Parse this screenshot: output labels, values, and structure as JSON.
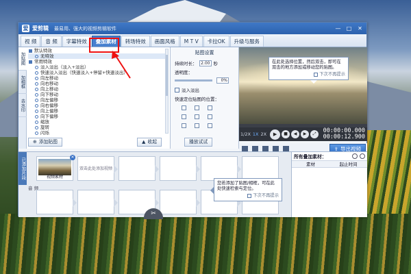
{
  "colors": {
    "accent": "#4680cf",
    "titlebar": "#2c62ae",
    "highlight": "#e11111"
  },
  "app": {
    "logo_glyph": "爱",
    "name": "爱剪辑",
    "slogan": "最易用、强大的视频剪辑软件",
    "win_minimize": "—",
    "win_maximize": "□",
    "win_close": "✕"
  },
  "tabs": [
    "视 频",
    "音 频",
    "字幕特效",
    "叠加素材",
    "转场特效",
    "画面风格",
    "M T V",
    "卡拉OK",
    "升级与服务"
  ],
  "sidetabs": [
    "加贴图",
    "加相框",
    "去水印"
  ],
  "tree": [
    {
      "type": "group",
      "label": "默认特效"
    },
    {
      "type": "item",
      "label": "无特效",
      "selected": true
    },
    {
      "type": "group",
      "label": "常用特效"
    },
    {
      "type": "item",
      "label": "淡入淡出（淡入+淡出）"
    },
    {
      "type": "item",
      "label": "快速淡入淡出（快速淡入+停留+快速淡出）"
    },
    {
      "type": "item",
      "label": "向左移动"
    },
    {
      "type": "item",
      "label": "向右移动"
    },
    {
      "type": "item",
      "label": "向上移动"
    },
    {
      "type": "item",
      "label": "向下移动"
    },
    {
      "type": "item",
      "label": "向左偏移"
    },
    {
      "type": "item",
      "label": "向右偏移"
    },
    {
      "type": "item",
      "label": "向上偏移"
    },
    {
      "type": "item",
      "label": "向下偏移"
    },
    {
      "type": "item",
      "label": "缩放"
    },
    {
      "type": "item",
      "label": "旋转"
    },
    {
      "type": "item",
      "label": "闪烁"
    }
  ],
  "left_footer": {
    "add_label": "添加贴图",
    "collapse_label": "收起"
  },
  "settings": {
    "title": "贴图设置",
    "duration_label": "持续时长：",
    "duration_value": "2.00",
    "duration_unit": "秒",
    "opacity_label": "透明度：",
    "opacity_value": "0%",
    "fade_label": "淡入淡出",
    "position_label": "快速定位贴图的位置：",
    "preview_btn": "播放试试"
  },
  "preview_tip": {
    "text": "在此处选择位置，然后双击，即可在双击的地方添加或移动您的贴图。",
    "dont_show": "下次不再提示"
  },
  "player": {
    "speed": [
      "1/2X",
      "1X",
      "2X"
    ],
    "speed_selected": "1X",
    "time_current": "00:00:00.000",
    "time_total": "00:00:12.900",
    "progress": 0.0,
    "volume": 0.55,
    "export_label": "导出视频"
  },
  "timeline": {
    "track_tab": "已添加片段",
    "clip_name": "视频素材",
    "drop_hint": "双击此处添加视频",
    "audio_label": "音 频",
    "tip_text": "您若添加了贴图/相框，可在此处快速检索与定位。",
    "tip_dont_show": "下次不再提示"
  },
  "overlay_panel": {
    "title": "所有叠加素材：",
    "col_material": "素材",
    "col_start": "起止时间"
  }
}
